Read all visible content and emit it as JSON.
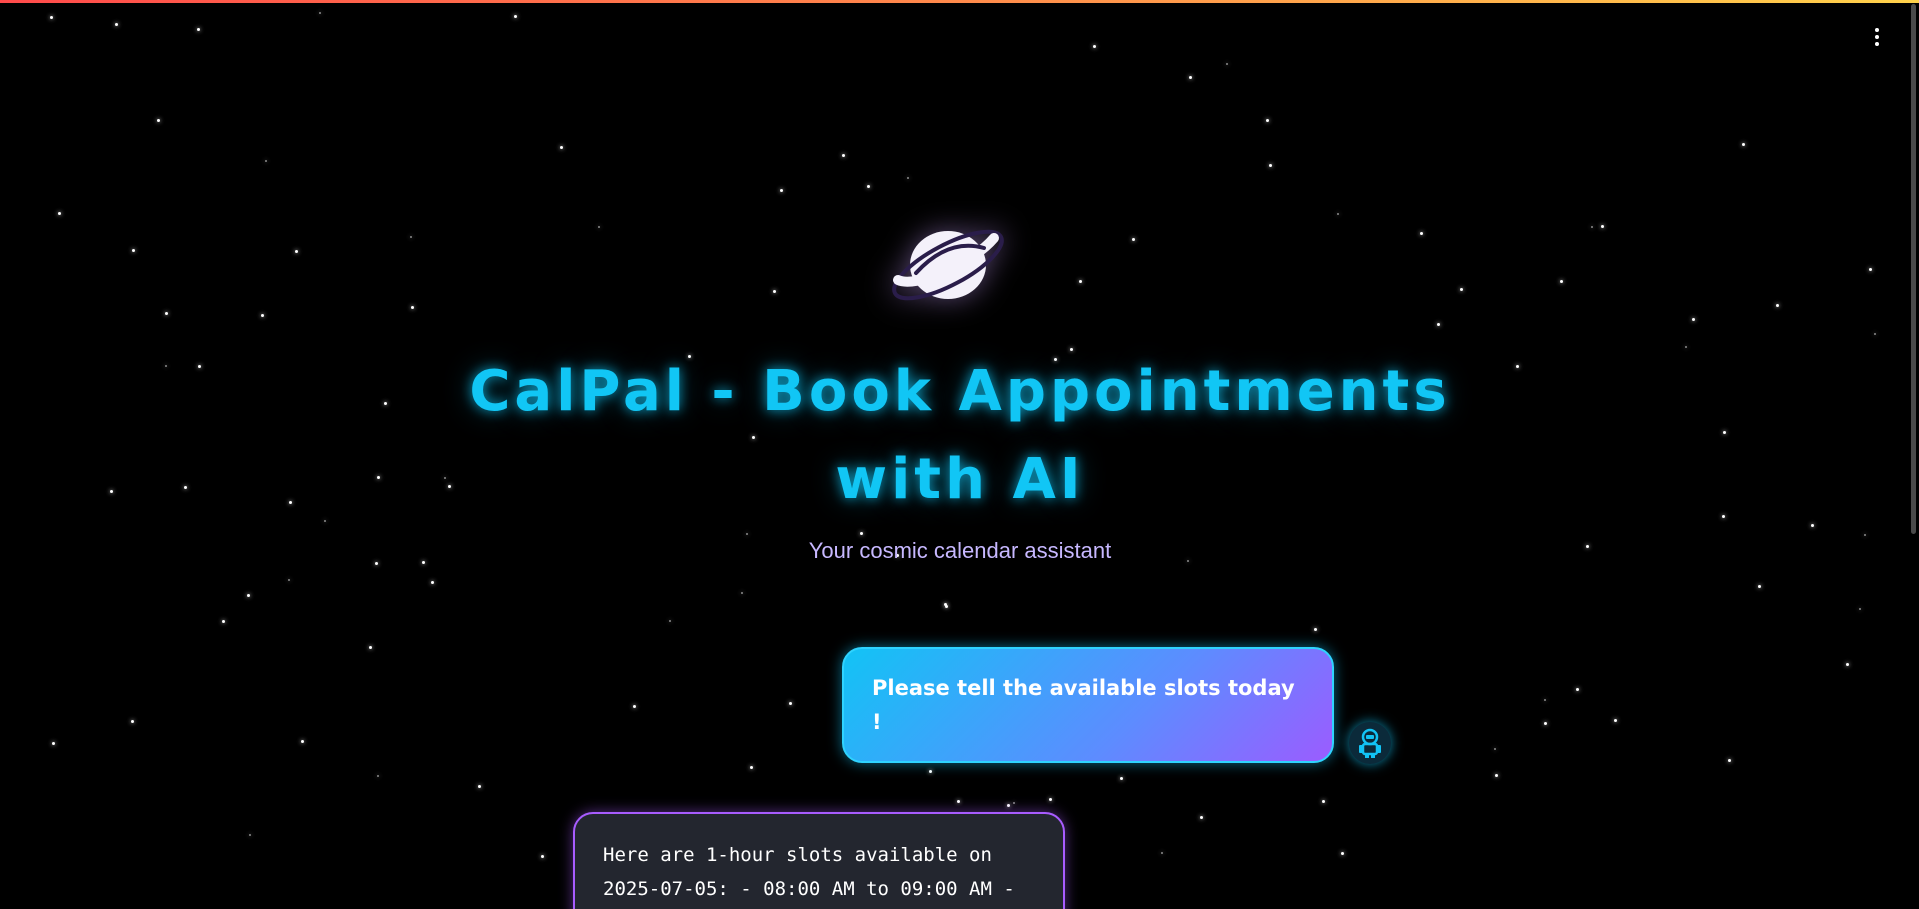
{
  "header": {
    "title": "CalPal - Book Appointments with AI",
    "subtitle": "Your cosmic calendar assistant"
  },
  "icons": {
    "logo": "ringed-planet-icon",
    "menu": "vertical-ellipsis-icon",
    "user_avatar": "astronaut-icon"
  },
  "chat": {
    "messages": [
      {
        "role": "user",
        "text": "Please tell the available slots today !"
      },
      {
        "role": "assistant",
        "text": "Here are 1-hour slots available on 2025-07-05: - 08:00 AM to 09:00 AM -"
      }
    ]
  },
  "colors": {
    "background": "#000000",
    "title": "#11c6f5",
    "subtitle": "#c7b8ff",
    "user_bubble_start": "#12c3f5",
    "user_bubble_end": "#9b5cff",
    "assistant_bubble_bg": "#23262f",
    "assistant_bubble_border": "#a85cff",
    "top_bar_gradient_start": "#ff4b4b",
    "top_bar_gradient_end": "#ffd24b"
  }
}
